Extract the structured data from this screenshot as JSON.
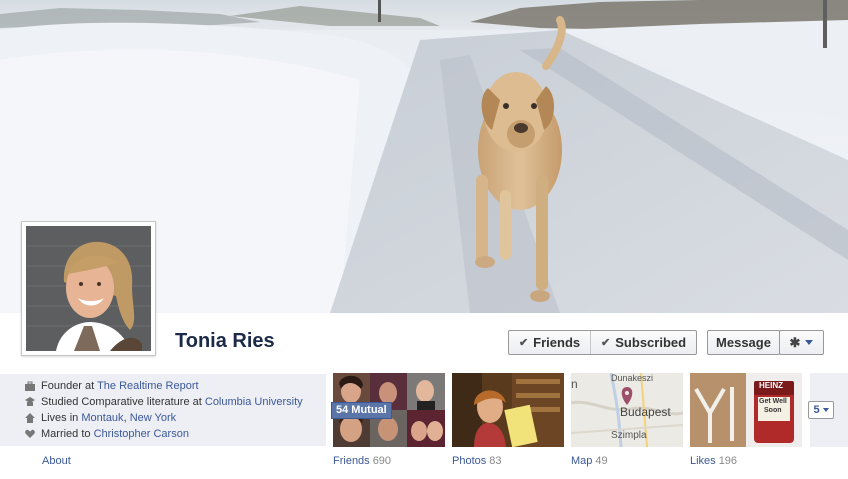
{
  "profile": {
    "name": "Tonia Ries"
  },
  "actions": {
    "friends_label": "Friends",
    "subscribed_label": "Subscribed",
    "message_label": "Message"
  },
  "info": [
    {
      "icon": "briefcase-icon",
      "prefix": "Founder at ",
      "link": "The Realtime Report",
      "mid": "",
      "link2": ""
    },
    {
      "icon": "education-icon",
      "prefix": "Studied Comparative literature at ",
      "link": "Columbia University",
      "mid": "",
      "link2": ""
    },
    {
      "icon": "home-icon",
      "prefix": "Lives in ",
      "link": "Montauk",
      "mid": ", ",
      "link2": "New York"
    },
    {
      "icon": "heart-icon",
      "prefix": "Married to ",
      "link": "Christopher Carson",
      "mid": "",
      "link2": ""
    }
  ],
  "about_label": "About",
  "tiles": {
    "friends": {
      "label": "Friends",
      "count": "690",
      "badge": "54 Mutual"
    },
    "photos": {
      "label": "Photos",
      "count": "83"
    },
    "map": {
      "label": "Map",
      "count": "49",
      "city": "Budapest",
      "place1": "Dunakeszi",
      "place2": "Szimpla"
    },
    "likes": {
      "label": "Likes",
      "count": "196",
      "heinz_brand": "HEINZ",
      "heinz_line1": "Get Well",
      "heinz_line2": "Soon"
    }
  },
  "more_count": "5",
  "colors": {
    "link": "#3b5998",
    "name": "#1c2a47",
    "info_bg": "#edeff4",
    "badge_bg": "#5c75a9"
  }
}
